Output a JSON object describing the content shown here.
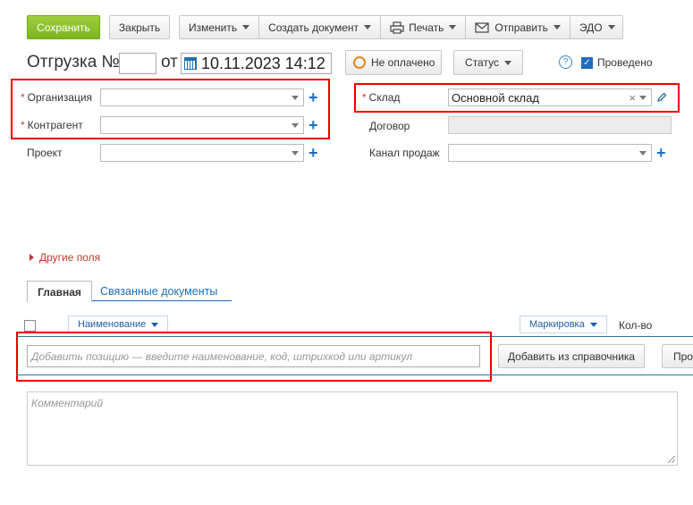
{
  "toolbar": {
    "save": "Сохранить",
    "close": "Закрыть",
    "edit": "Изменить",
    "create_doc": "Создать документ",
    "print": "Печать",
    "send": "Отправить",
    "edo": "ЭДО"
  },
  "header": {
    "title": "Отгрузка №",
    "number": "",
    "from": "от",
    "datetime": "10.11.2023 14:12",
    "payment_status": "Не оплачено",
    "status": "Статус",
    "help": "?",
    "posted_label": "Проведено",
    "posted": true
  },
  "fields_left": {
    "organization_label": "Организация",
    "organization_value": "",
    "counterparty_label": "Контрагент",
    "counterparty_value": "",
    "project_label": "Проект",
    "project_value": ""
  },
  "fields_right": {
    "warehouse_label": "Склад",
    "warehouse_value": "Основной склад",
    "contract_label": "Договор",
    "contract_value": "",
    "sales_channel_label": "Канал продаж",
    "sales_channel_value": ""
  },
  "other_fields": "Другие поля",
  "tabs": {
    "main": "Главная",
    "related": "Связанные документы"
  },
  "table": {
    "col_name": "Наименование",
    "col_marking": "Маркировка",
    "col_qty": "Кол-во"
  },
  "positions": {
    "add_placeholder": "Добавить позицию — введите наименование, код, штрихкод или артикул",
    "add_from_catalog": "Добавить из справочника",
    "more_button": "Про"
  },
  "comment_placeholder": "Комментарий",
  "colors": {
    "save_green": "#8cc22e",
    "link_blue": "#1e6ec0",
    "required_red": "#dd3333",
    "highlight_red": "#ee0000",
    "unpaid_orange": "#e08a1e"
  }
}
